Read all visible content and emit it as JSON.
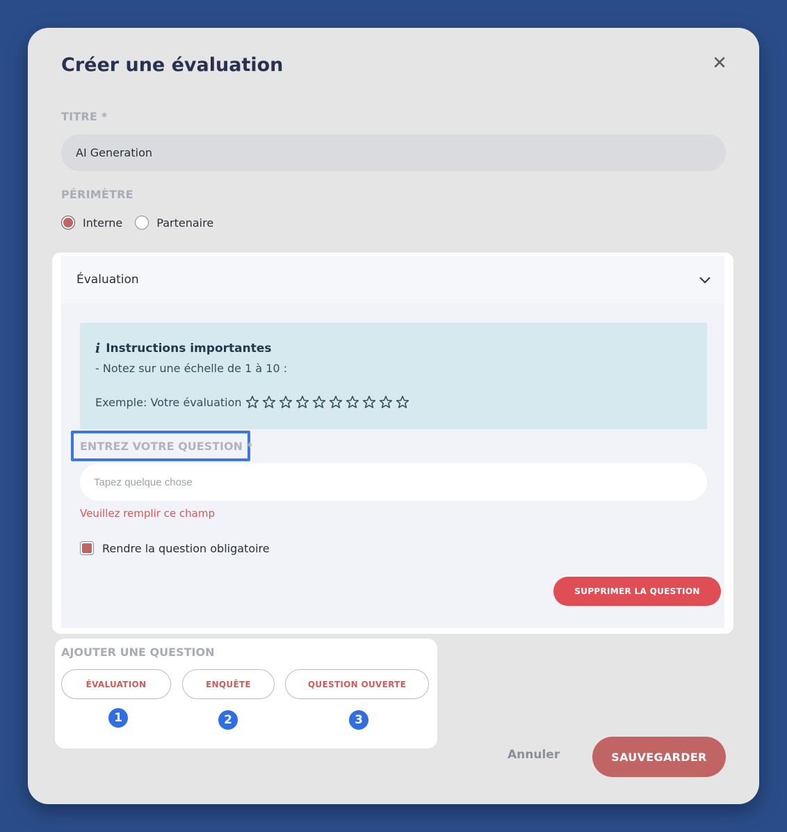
{
  "modal": {
    "title": "Créer une évaluation",
    "close_icon": "close-icon"
  },
  "form": {
    "titre_label": "TITRE *",
    "titre_value": "AI Generation",
    "perimetre_label": "PÉRIMÈTRE",
    "perimetre_options": [
      {
        "label": "Interne",
        "checked": true
      },
      {
        "label": "Partenaire",
        "checked": false
      }
    ]
  },
  "question": {
    "accordion_title": "Évaluation",
    "info": {
      "icon": "info-icon",
      "title": "Instructions importantes",
      "line": "- Notez sur une échelle de 1 à 10 :",
      "example": "Exemple: Votre évaluation",
      "stars_count": 10
    },
    "question_label": "ENTREZ VOTRE QUESTION *",
    "question_placeholder": "Tapez quelque chose",
    "error": "Veuillez remplir ce champ",
    "mandatory_label": "Rendre la question obligatoire",
    "mandatory_checked": true,
    "delete_button": "SUPPRIMER LA QUESTION"
  },
  "add_question": {
    "label": "AJOUTER UNE QUESTION",
    "buttons": [
      {
        "label": "ÉVALUATION",
        "badge": "1"
      },
      {
        "label": "ENQUÊTE",
        "badge": "2"
      },
      {
        "label": "QUESTION OUVERTE",
        "badge": "3"
      }
    ]
  },
  "footer": {
    "cancel": "Annuler",
    "save": "SAUVEGARDER"
  },
  "colors": {
    "background": "#2a4d8a",
    "accent": "#c06464",
    "delete": "#e04e55",
    "badge": "#2f6fe0",
    "info_bg": "#d5e9ee"
  }
}
